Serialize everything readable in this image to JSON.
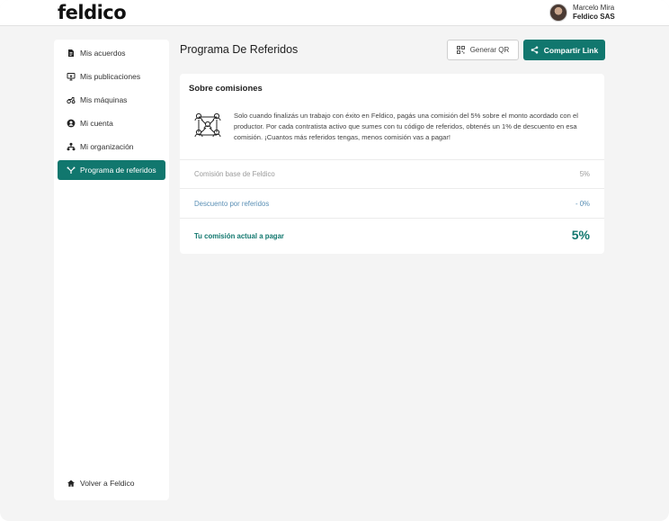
{
  "brand": {
    "logo_text": "feldico",
    "accent_color": "#11776e"
  },
  "user": {
    "name": "Marcelo Mira",
    "organization": "Feldico SAS"
  },
  "sidebar": {
    "items": [
      {
        "label": "Mis acuerdos",
        "icon": "document-icon"
      },
      {
        "label": "Mis publicaciones",
        "icon": "monitor-icon"
      },
      {
        "label": "Mis máquinas",
        "icon": "tractor-icon"
      },
      {
        "label": "Mi cuenta",
        "icon": "user-circle-icon"
      },
      {
        "label": "Mi organización",
        "icon": "org-chart-icon"
      },
      {
        "label": "Programa de referidos",
        "icon": "referral-icon",
        "active": true
      }
    ],
    "footer": {
      "label": "Volver a Feldico",
      "icon": "home-icon"
    }
  },
  "main": {
    "title": "Programa De Referidos",
    "qr_button": "Generar QR",
    "share_button": "Compartir Link",
    "card": {
      "title": "Sobre comisiones",
      "description": "Solo cuando finalizás un trabajo con éxito en Feldico, pagás una comisión del 5% sobre el monto acordado con el productor. Por cada contratista activo que sumes con tu código de referidos, obtenés un 1% de descuento en esa comisión. ¡Cuantos más referidos tengas, menos comisión vas a pagar!",
      "rows": [
        {
          "label": "Comisión base de Feldico",
          "value": "5%"
        },
        {
          "label": "Descuento por referidos",
          "value": "- 0%"
        },
        {
          "label": "Tu comisión actual a pagar",
          "value": "5%"
        }
      ]
    }
  }
}
